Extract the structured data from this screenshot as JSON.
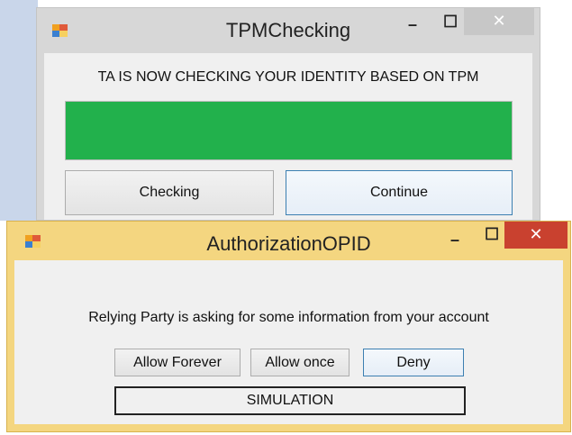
{
  "tpm_window": {
    "title": "TPMChecking",
    "minimize_glyph": "–",
    "maximize_glyph": "☐",
    "close_glyph": "✕",
    "message": "TA IS NOW CHECKING YOUR IDENTITY BASED ON TPM",
    "progress_fraction": 1.0,
    "progress_color": "#22b14c",
    "checking_button_label": "Checking",
    "continue_button_label": "Continue"
  },
  "auth_window": {
    "title": "AuthorizationOPID",
    "minimize_glyph": "–",
    "maximize_glyph": "☐",
    "close_glyph": "✕",
    "message": "Relying Party is asking for some information from your account",
    "allow_forever_label": "Allow Forever",
    "allow_once_label": "Allow once",
    "deny_label": "Deny",
    "status_text": "SIMULATION",
    "close_color": "#c9412f",
    "frame_color": "#f4d680"
  }
}
